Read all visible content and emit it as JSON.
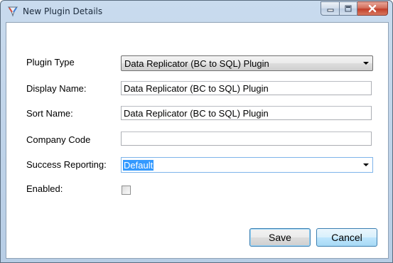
{
  "window": {
    "title": "New Plugin Details",
    "app_icon": "plugin-app-icon",
    "caption_buttons": [
      "minimize-icon",
      "maximize-icon",
      "close-icon"
    ]
  },
  "form": {
    "plugin_type": {
      "label": "Plugin Type",
      "value": "Data Replicator (BC to SQL) Plugin"
    },
    "display_name": {
      "label": "Display Name:",
      "value": "Data Replicator (BC to SQL) Plugin"
    },
    "sort_name": {
      "label": "Sort Name:",
      "value": "Data Replicator (BC to SQL) Plugin"
    },
    "company_code": {
      "label": "Company Code",
      "value": ""
    },
    "success_reporting": {
      "label": "Success Reporting:",
      "value": "Default"
    },
    "enabled": {
      "label": "Enabled:",
      "checked": false
    }
  },
  "buttons": {
    "save_label": "Save",
    "cancel_label": "Cancel"
  },
  "colors": {
    "selection": "#3399ff",
    "close_button": "#c23f2a",
    "title_bar": "#c9dbee"
  }
}
